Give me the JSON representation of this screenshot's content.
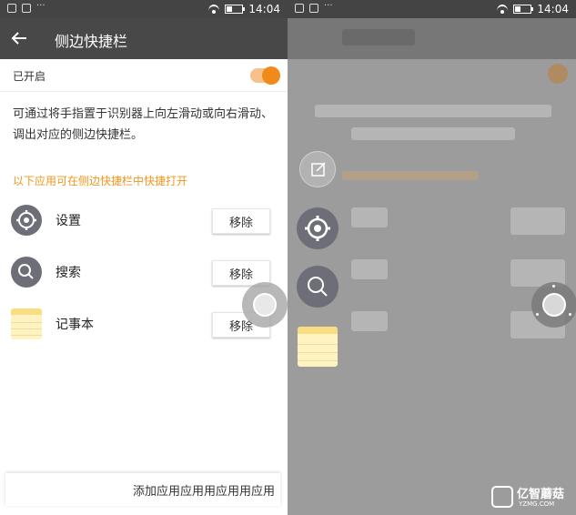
{
  "status_bar": {
    "time": "14:04"
  },
  "header": {
    "title": "侧边快捷栏"
  },
  "toggle": {
    "label": "已开启",
    "state": "on",
    "color": "#f08a1a"
  },
  "description": "可通过将手指置于识别器上向左滑动或向右滑动、调出对应的侧边快捷栏。",
  "apps_header": "以下应用可在侧边快捷栏中快捷打开",
  "apps": [
    {
      "name": "设置",
      "icon": "gear-icon",
      "remove_label": "移除"
    },
    {
      "name": "搜索",
      "icon": "search-icon",
      "remove_label": "移除"
    },
    {
      "name": "记事本",
      "icon": "notepad-icon",
      "remove_label": "移除"
    }
  ],
  "add_button": {
    "label": "添加应用应用用应用用应用"
  },
  "sidebar_preview": {
    "items": [
      {
        "icon": "edit-note-icon"
      },
      {
        "icon": "gear-icon"
      },
      {
        "icon": "search-icon"
      },
      {
        "icon": "notepad-icon"
      }
    ]
  },
  "watermark": {
    "name": "亿智蘑菇",
    "domain": "YZMG.COM"
  },
  "colors": {
    "accent": "#f08a1a",
    "app_bar": "#484848",
    "icon_circle": "#6e6e78",
    "notepad": "#fff3c2"
  }
}
